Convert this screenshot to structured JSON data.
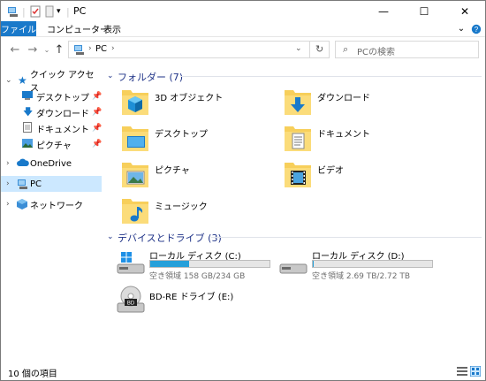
{
  "window": {
    "title": "PC",
    "min": "—",
    "max": "☐",
    "close": "✕"
  },
  "ribbon": {
    "file": "ファイル",
    "computer": "コンピューター",
    "view": "表示"
  },
  "nav": {
    "breadcrumb": "PC",
    "search_placeholder": "PCの検索"
  },
  "sidebar": {
    "quick_access": "クイック アクセス",
    "items": [
      {
        "label": "デスクトップ"
      },
      {
        "label": "ダウンロード"
      },
      {
        "label": "ドキュメント"
      },
      {
        "label": "ピクチャ"
      }
    ],
    "onedrive": "OneDrive",
    "pc": "PC",
    "network": "ネットワーク"
  },
  "content": {
    "folders_header": "フォルダー (7)",
    "folders": [
      {
        "label": "3D オブジェクト",
        "icon": "3d-objects-folder-icon"
      },
      {
        "label": "ダウンロード",
        "icon": "downloads-folder-icon"
      },
      {
        "label": "デスクトップ",
        "icon": "desktop-folder-icon"
      },
      {
        "label": "ドキュメント",
        "icon": "documents-folder-icon"
      },
      {
        "label": "ピクチャ",
        "icon": "pictures-folder-icon"
      },
      {
        "label": "ビデオ",
        "icon": "videos-folder-icon"
      },
      {
        "label": "ミュージック",
        "icon": "music-folder-icon"
      }
    ],
    "drives_header": "デバイスとドライブ (3)",
    "drives": [
      {
        "label": "ローカル ディスク (C:)",
        "free": "空き領域 158 GB/234 GB",
        "used_fraction": 0.325
      },
      {
        "label": "ローカル ディスク (D:)",
        "free": "空き領域 2.69 TB/2.72 TB",
        "used_fraction": 0.011
      },
      {
        "label": "BD-RE ドライブ (E:)"
      }
    ]
  },
  "status": {
    "count": "10 個の項目"
  },
  "colors": {
    "accent": "#1979ca",
    "group_header": "#1e3287",
    "selection": "#cce8ff",
    "drive_fill": "#26a0da",
    "folder": "#f7cf5b"
  }
}
